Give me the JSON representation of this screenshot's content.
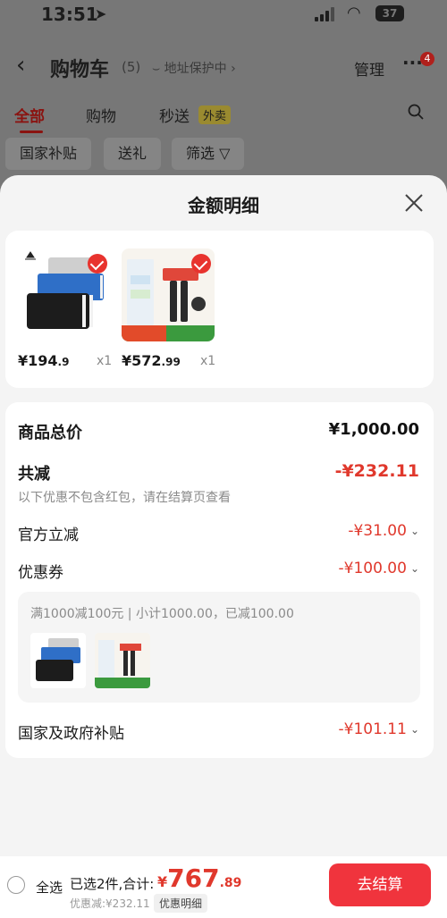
{
  "status_bar": {
    "time": "13:51",
    "battery": "37"
  },
  "nav": {
    "title": "购物车",
    "count": "(5)",
    "address_protect": "地址保护中",
    "manage": "管理",
    "badge": "4"
  },
  "tabs": [
    {
      "label": "全部",
      "active": true
    },
    {
      "label": "购物"
    },
    {
      "label": "秒送"
    }
  ],
  "tab_badge": "外卖",
  "filters": [
    "国家补贴",
    "送礼",
    "筛选"
  ],
  "sheet": {
    "title": "金额明细",
    "products": [
      {
        "price_int": "¥194",
        "price_dec": ".9",
        "qty": "x1",
        "checked": true
      },
      {
        "price_int": "¥572",
        "price_dec": ".99",
        "qty": "x1",
        "checked": true
      }
    ],
    "summary": {
      "total_label": "商品总价",
      "total_value": "¥1,000.00",
      "reduce_label": "共减",
      "reduce_value": "-¥232.11",
      "reduce_note": "以下优惠不包含红包，请在结算页查看",
      "official_label": "官方立减",
      "official_value": "-¥31.00",
      "coupon_label": "优惠券",
      "coupon_value": "-¥100.00",
      "coupon_desc": "满1000减100元 | 小计1000.00，已减100.00",
      "subsidy_label": "国家及政府补贴",
      "subsidy_value": "-¥101.11"
    }
  },
  "bottom_bar": {
    "select_all": "全选",
    "selected": "已选2件,合计:",
    "sum_currency": "¥",
    "sum_int": "767",
    "sum_dec": ".89",
    "discount": "优惠减:¥232.11",
    "detail": "优惠明细",
    "checkout": "去结算"
  },
  "colors": {
    "accent_red": "#e0382c",
    "button_red": "#f0343d"
  }
}
